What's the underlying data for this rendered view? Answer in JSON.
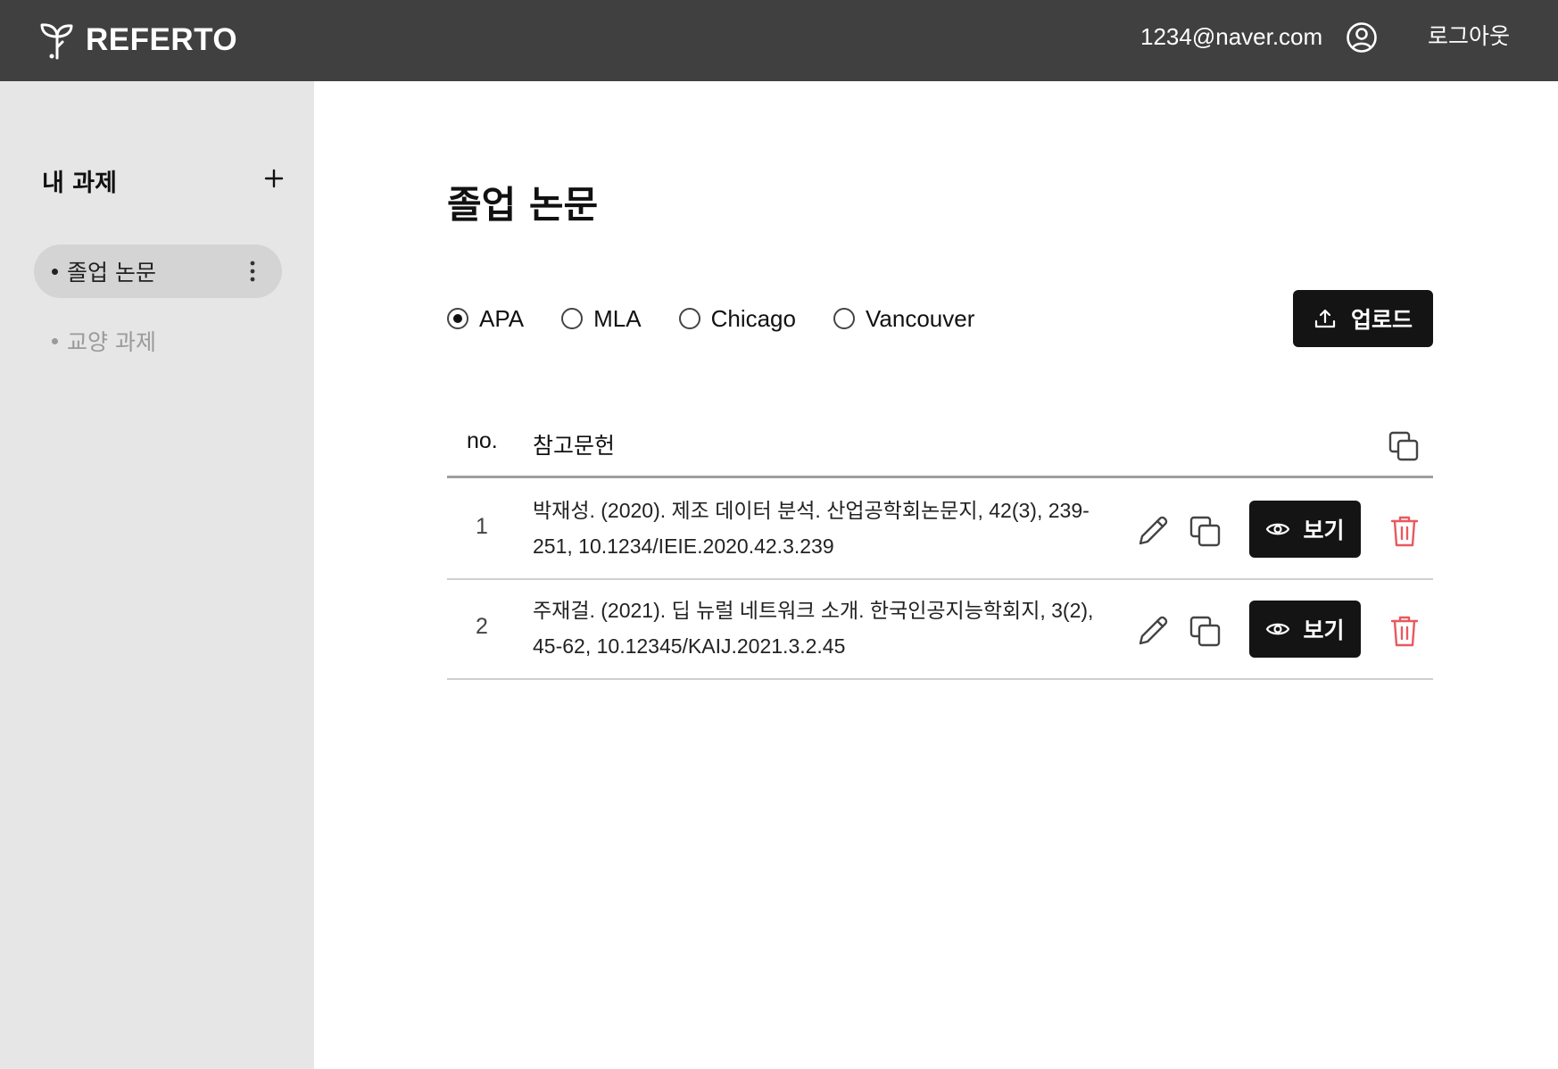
{
  "header": {
    "brand": "REFERTO",
    "email": "1234@naver.com",
    "logout": "로그아웃"
  },
  "sidebar": {
    "title": "내 과제",
    "items": [
      {
        "label": "졸업 논문",
        "active": true
      },
      {
        "label": "교양 과제",
        "active": false
      }
    ]
  },
  "main": {
    "title": "졸업 논문",
    "citation_styles": [
      {
        "label": "APA",
        "selected": true
      },
      {
        "label": "MLA",
        "selected": false
      },
      {
        "label": "Chicago",
        "selected": false
      },
      {
        "label": "Vancouver",
        "selected": false
      }
    ],
    "upload_label": "업로드",
    "table": {
      "col_no": "no.",
      "col_ref": "참고문헌",
      "rows": [
        {
          "no": "1",
          "reference": "박재성. (2020). 제조 데이터 분석. 산업공학회논문지, 42(3), 239-251, 10.1234/IEIE.2020.42.3.239",
          "view_label": "보기"
        },
        {
          "no": "2",
          "reference": "주재걸. (2021). 딥 뉴럴 네트워크 소개. 한국인공지능학회지, 3(2), 45-62, 10.12345/KAIJ.2021.3.2.45",
          "view_label": "보기"
        }
      ]
    }
  },
  "colors": {
    "header_bg": "#404040",
    "sidebar_bg": "#e6e6e6",
    "active_item_bg": "#d4d4d4",
    "primary_button": "#141414",
    "delete_icon": "#e8595e"
  },
  "icons": [
    "sprout-logo-icon",
    "user-circle-icon",
    "plus-icon",
    "kebab-menu-icon",
    "upload-icon",
    "copy-icon",
    "pencil-icon",
    "eye-icon",
    "trash-icon"
  ]
}
